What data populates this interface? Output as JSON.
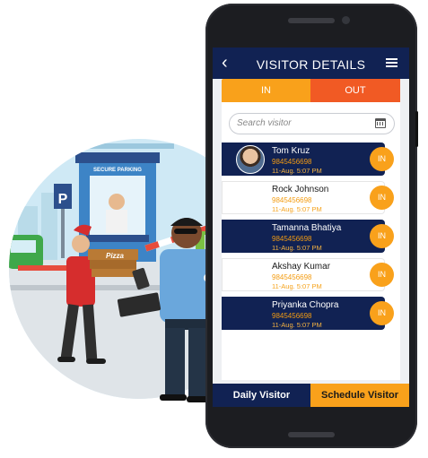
{
  "colors": {
    "navy": "#112253",
    "orange": "#f9a11b",
    "out_orange": "#f15a24"
  },
  "scene": {
    "parking_sign": "SECURE PARKING",
    "p_icon": "P",
    "box_label": "Pizza"
  },
  "header": {
    "title": "VISITOR DETAILS",
    "back_icon": "chevron-left-icon",
    "menu_icon": "hamburger-menu-icon"
  },
  "tabs": {
    "in_label": "IN",
    "out_label": "OUT"
  },
  "search": {
    "placeholder": "Search visitor",
    "icon": "calendar-icon"
  },
  "visitors": [
    {
      "name": "Tom Kruz",
      "phone": "9845456698",
      "time": "11-Aug.   5:07 PM",
      "action": "IN"
    },
    {
      "name": "Rock Johnson",
      "phone": "9845456698",
      "time": "11-Aug.   5:07 PM",
      "action": "IN"
    },
    {
      "name": "Tamanna Bhatiya",
      "phone": "9845456698",
      "time": "11-Aug.   5:07 PM",
      "action": "IN"
    },
    {
      "name": "Akshay Kumar",
      "phone": "9845456698",
      "time": "11-Aug.   5:07 PM",
      "action": "IN"
    },
    {
      "name": "Priyanka Chopra",
      "phone": "9845456698",
      "time": "11-Aug.   5:07 PM",
      "action": "IN"
    }
  ],
  "footer": {
    "daily_label": "Daily Visitor",
    "schedule_label": "Schedule Visitor"
  }
}
